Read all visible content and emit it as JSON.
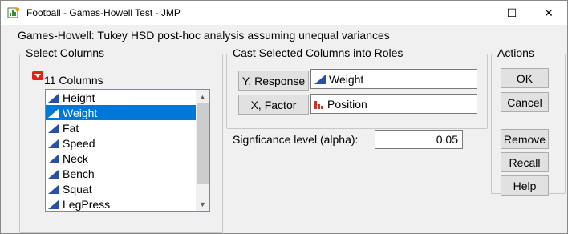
{
  "window": {
    "title": "Football - Games-Howell Test - JMP",
    "minimize_glyph": "—",
    "maximize_glyph": "☐",
    "close_glyph": "✕"
  },
  "subtitle": "Games-Howell: Tukey HSD post-hoc analysis assuming unequal variances",
  "select_columns": {
    "legend": "Select Columns",
    "count_label": "11 Columns",
    "items": [
      {
        "label": "Height",
        "icon": "continuous-icon",
        "selected": false
      },
      {
        "label": "Weight",
        "icon": "continuous-icon",
        "selected": true
      },
      {
        "label": "Fat",
        "icon": "continuous-icon",
        "selected": false
      },
      {
        "label": "Speed",
        "icon": "continuous-icon",
        "selected": false
      },
      {
        "label": "Neck",
        "icon": "continuous-icon",
        "selected": false
      },
      {
        "label": "Bench",
        "icon": "continuous-icon",
        "selected": false
      },
      {
        "label": "Squat",
        "icon": "continuous-icon",
        "selected": false
      },
      {
        "label": "LegPress",
        "icon": "continuous-icon",
        "selected": false
      }
    ]
  },
  "cast": {
    "legend": "Cast Selected Columns into Roles",
    "response_button": "Y, Response",
    "response_value": "Weight",
    "factor_button": "X, Factor",
    "factor_value": "Position"
  },
  "alpha": {
    "label": "Signficance level (alpha):",
    "value": "0.05"
  },
  "actions": {
    "legend": "Actions",
    "ok": "OK",
    "cancel": "Cancel",
    "remove": "Remove",
    "recall": "Recall",
    "help": "Help"
  },
  "colors": {
    "selection": "#0078d7",
    "continuous_icon": "#2a4fa8",
    "nominal_icon": "#c0392b",
    "hotspot": "#d9251c"
  }
}
